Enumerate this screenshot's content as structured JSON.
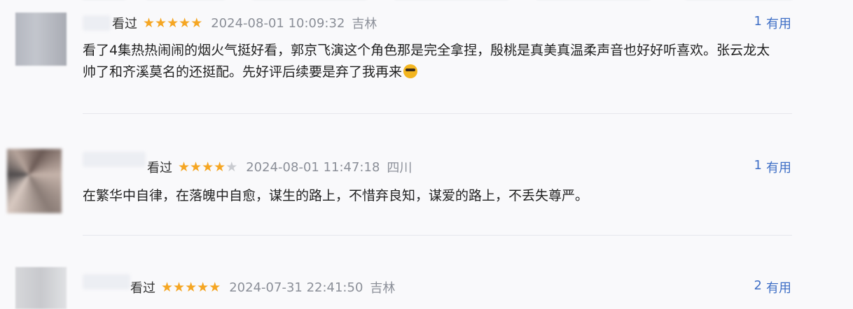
{
  "reviews": [
    {
      "status": "看过",
      "stars": 5,
      "time": "2024-08-01 10:09:32",
      "location": "吉林",
      "useful_count": "1",
      "useful_label": "有用",
      "text": "看了4集热热闹闹的烟火气挺好看，郭京飞演这个角色那是完全拿捏，殷桃是真美真温柔声音也好好听喜欢。张云龙太帅了和齐溪莫名的还挺配。先好评后续要是弃了我再来",
      "emoji": "sunglasses-emoji"
    },
    {
      "status": "看过",
      "stars": 4,
      "time": "2024-08-01 11:47:18",
      "location": "四川",
      "useful_count": "1",
      "useful_label": "有用",
      "text": "在繁华中自律，在落魄中自愈，谋生的路上，不惜弃良知，谋爱的路上，不丢失尊严。"
    },
    {
      "status": "看过",
      "stars": 5,
      "time": "2024-07-31 22:41:50",
      "location": "吉林",
      "useful_count": "2",
      "useful_label": "有用"
    }
  ],
  "colors": {
    "star": "#f5a623",
    "star_off": "#c9cbd0",
    "link": "#3f6fc6",
    "meta": "#8b8f98"
  }
}
